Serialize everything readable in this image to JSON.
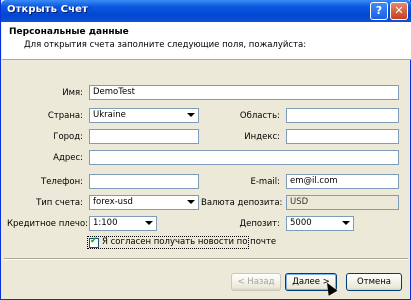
{
  "window": {
    "title": "Открыть Счет",
    "help_label": "?",
    "close_label": "✕"
  },
  "header": {
    "title": "Персональные данные",
    "subtitle": "Для открытия счета заполните следующие поля, пожалуйста:"
  },
  "form": {
    "name": {
      "label": "Имя:",
      "value": "DemoTest"
    },
    "country": {
      "label": "Страна:",
      "value": "Ukraine"
    },
    "region": {
      "label": "Область:",
      "value": ""
    },
    "city": {
      "label": "Город:",
      "value": ""
    },
    "zip": {
      "label": "Индекс:",
      "value": ""
    },
    "address": {
      "label": "Адрес:",
      "value": ""
    },
    "phone": {
      "label": "Телефон:",
      "value": ""
    },
    "email": {
      "label": "E-mail:",
      "value": "em@il.com"
    },
    "account_type": {
      "label": "Тип счета:",
      "value": "forex-usd"
    },
    "deposit_currency": {
      "label": "Валюта депозита:",
      "value": "USD"
    },
    "leverage": {
      "label": "Кредитное плечо:",
      "value": "1:100"
    },
    "deposit": {
      "label": "Депозит:",
      "value": "5000"
    },
    "newsletter": {
      "label": "Я согласен получать новости по почте",
      "checked": true
    }
  },
  "buttons": {
    "back": "< Назад",
    "next": "Далее >",
    "cancel": "Отмена"
  }
}
